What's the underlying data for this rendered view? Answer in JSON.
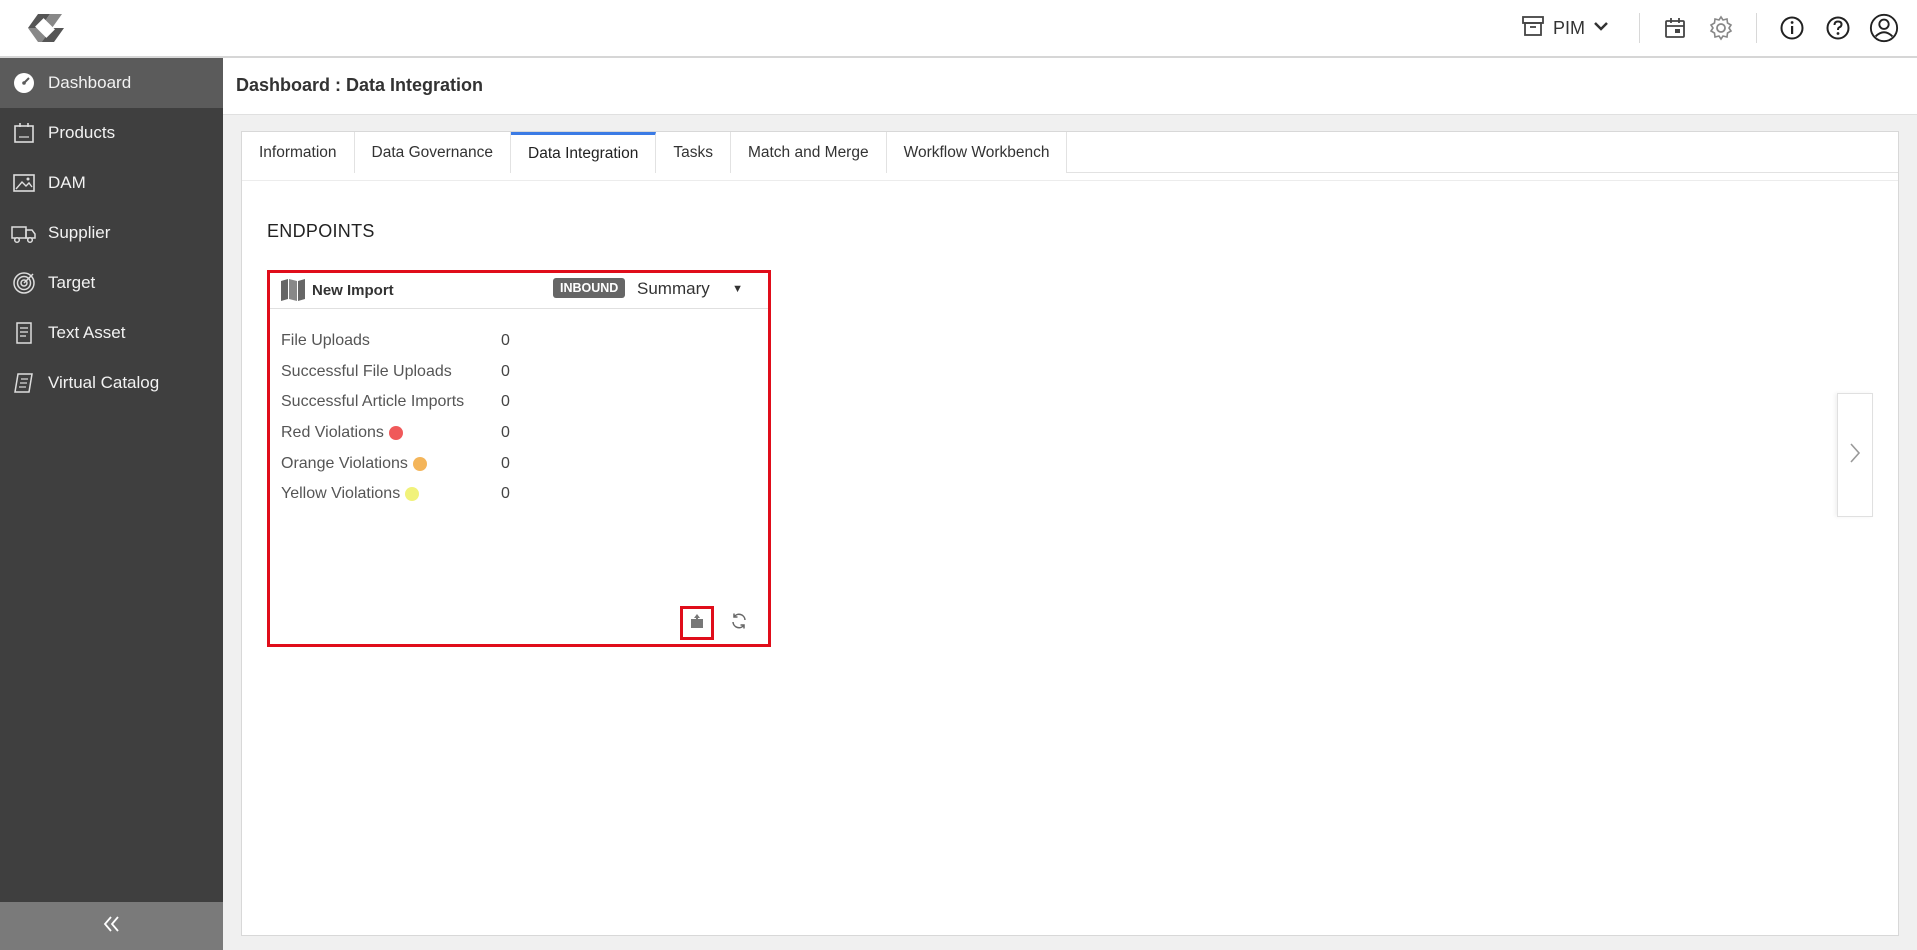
{
  "header": {
    "app_select": "PIM",
    "icons": [
      "archive-icon",
      "chevron-down-icon",
      "calendar-icon",
      "gear-icon",
      "info-icon",
      "help-icon",
      "user-icon"
    ]
  },
  "sidebar": {
    "items": [
      {
        "label": "Dashboard",
        "icon": "dashboard-icon",
        "active": true
      },
      {
        "label": "Products",
        "icon": "products-icon"
      },
      {
        "label": "DAM",
        "icon": "image-icon"
      },
      {
        "label": "Supplier",
        "icon": "truck-icon"
      },
      {
        "label": "Target",
        "icon": "target-icon"
      },
      {
        "label": "Text Asset",
        "icon": "document-icon"
      },
      {
        "label": "Virtual Catalog",
        "icon": "catalog-icon"
      }
    ],
    "collapse_icon": "double-chevron-left-icon"
  },
  "page": {
    "title": "Dashboard : Data Integration"
  },
  "tabs": [
    {
      "label": "Information"
    },
    {
      "label": "Data Governance"
    },
    {
      "label": "Data Integration",
      "active": true
    },
    {
      "label": "Tasks"
    },
    {
      "label": "Match and Merge"
    },
    {
      "label": "Workflow Workbench"
    }
  ],
  "section": {
    "title": "ENDPOINTS"
  },
  "endpoint": {
    "name": "New Import",
    "badge": "INBOUND",
    "view_select": "Summary",
    "stats": [
      {
        "label": "File Uploads",
        "value": "0"
      },
      {
        "label": "Successful File Uploads",
        "value": "0"
      },
      {
        "label": "Successful Article Imports",
        "value": "0"
      },
      {
        "label": "Red Violations",
        "value": "0",
        "dot_color": "#f0595a"
      },
      {
        "label": "Orange Violations",
        "value": "0",
        "dot_color": "#f4b55a"
      },
      {
        "label": "Yellow Violations",
        "value": "0",
        "dot_color": "#f1f27a"
      }
    ],
    "actions": [
      "upload-icon",
      "refresh-icon"
    ]
  },
  "colors": {
    "sidebar_bg": "#3f3f3f",
    "sidebar_active": "#5b5b5b",
    "tab_active_accent": "#3b7be5",
    "highlight_border": "#e00d1a"
  }
}
